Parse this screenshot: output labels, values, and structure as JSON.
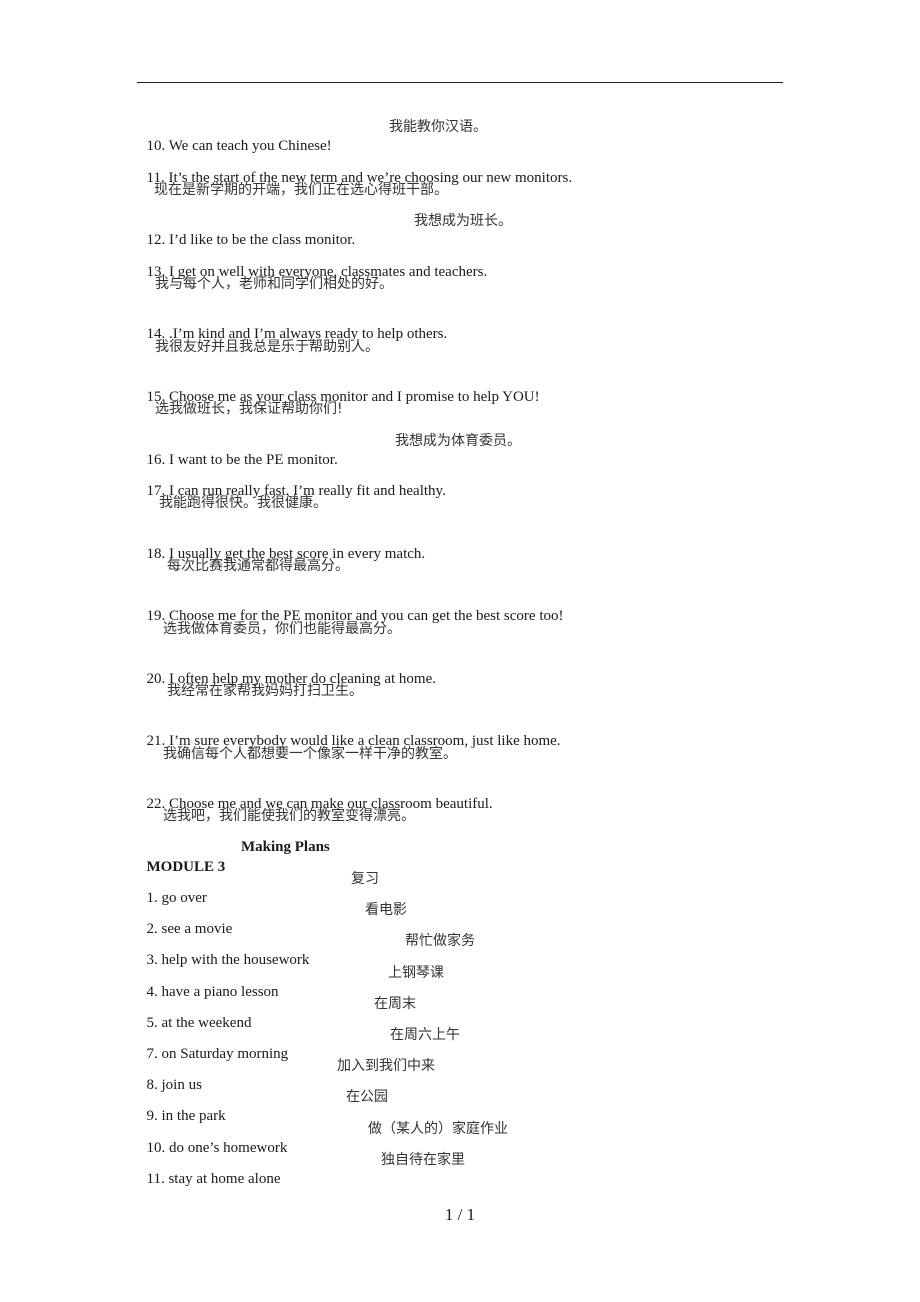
{
  "sentences": [
    {
      "en": "10. We can teach you Chinese!",
      "zh": "我能教你汉语。",
      "inline": true
    },
    {
      "en": "11. It’s the start of the new term and we’re choosing our new monitors.",
      "zh": "现在是新学期的开端，我们正在选心得班干部。",
      "inline": false
    },
    {
      "en": "12. I’d like to be the class monitor.",
      "zh": "我想成为班长。",
      "inline": true
    },
    {
      "en": "13. I get on well with everyone, classmates and teachers.",
      "zh": "我与每个人，老师和同学们相处的好。",
      "inline": false
    },
    {
      "en": "14. .I’m kind and I’m always ready to help others.",
      "zh": "我很友好并且我总是乐于帮助别人。",
      "inline": false
    },
    {
      "en": "15. Choose me as your class monitor and I promise to help YOU!",
      "zh": "选我做班长，我保证帮助你们!",
      "inline": false
    },
    {
      "en": "16. I want to be the PE monitor.",
      "zh": "我想成为体育委员。",
      "inline": true
    },
    {
      "en": "17. I can run really fast. I’m really fit and healthy.",
      "zh": "我能跑得很快。我很健康。",
      "inline": false
    },
    {
      "en": "18. I usually get the best score in every match.",
      "zh": "每次比赛我通常都得最高分。",
      "inline": false
    },
    {
      "en": "19. Choose me for the PE monitor and you can get the best score too!",
      "zh": "选我做体育委员，你们也能得最高分。",
      "inline": false
    },
    {
      "en": "20. I often help my mother do cleaning at home.",
      "zh": "我经常在家帮我妈妈打扫卫生。",
      "inline": false
    },
    {
      "en": "21. I’m sure everybody would like a clean classroom, just like home.",
      "zh": "我确信每个人都想要一个像家一样干净的教室。",
      "inline": false
    },
    {
      "en": "22. Choose me and we can make our classroom beautiful.",
      "zh": "选我吧，我们能使我们的教室变得漂亮。",
      "inline": false
    }
  ],
  "module": {
    "number": "MODULE 3",
    "title": "Making Plans"
  },
  "phrases": [
    {
      "en": "1. go over",
      "zh": "复习"
    },
    {
      "en": "2. see a movie",
      "zh": "看电影"
    },
    {
      "en": "3. help with the housework",
      "zh": "帮忙做家务"
    },
    {
      "en": "4. have a piano lesson",
      "zh": "上钢琴课"
    },
    {
      "en": "5. at the weekend",
      "zh": "在周末"
    },
    {
      "en": "7. on Saturday morning",
      "zh": "在周六上午"
    },
    {
      "en": "8. join us",
      "zh": "加入到我们中来"
    },
    {
      "en": "9. in the park",
      "zh": "在公园"
    },
    {
      "en": "10. do one’s homework",
      "zh": "做（某人的）家庭作业"
    },
    {
      "en": "11. stay at home alone",
      "zh": "独自待在家里"
    }
  ],
  "footer": {
    "page_indicator": "1 / 1"
  }
}
